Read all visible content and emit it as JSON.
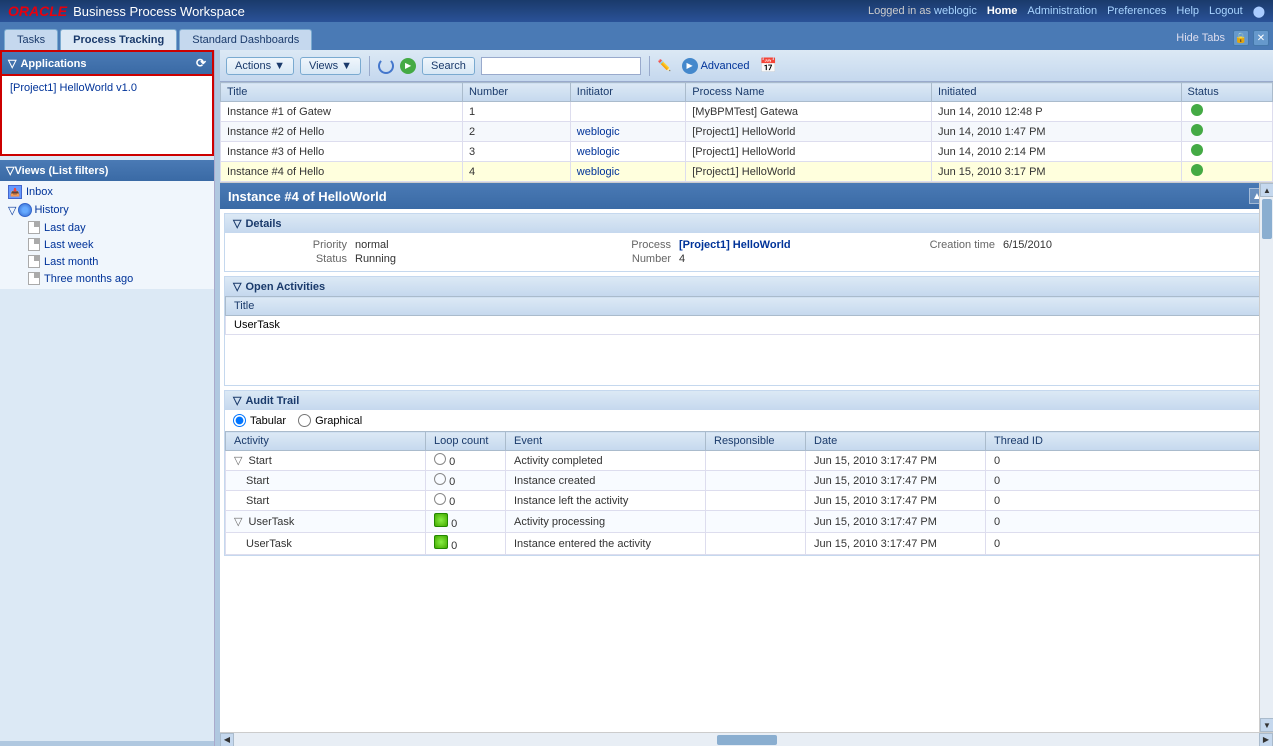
{
  "topbar": {
    "oracle_text": "ORACLE",
    "bpw_text": "Business Process Workspace",
    "logged_in_as": "Logged in as",
    "username": "weblogic",
    "home_label": "Home",
    "administration_label": "Administration",
    "preferences_label": "Preferences",
    "help_label": "Help",
    "logout_label": "Logout"
  },
  "tabs": {
    "tasks_label": "Tasks",
    "process_tracking_label": "Process Tracking",
    "standard_dashboards_label": "Standard Dashboards",
    "hide_tabs_label": "Hide Tabs"
  },
  "sidebar": {
    "applications_label": "Applications",
    "app_items": [
      {
        "label": "[Project1] HelloWorld v1.0"
      }
    ],
    "views_label": "Views (List filters)",
    "inbox_label": "Inbox",
    "history_label": "History",
    "tree_items": [
      {
        "label": "Last day"
      },
      {
        "label": "Last week"
      },
      {
        "label": "Last month"
      },
      {
        "label": "Three months ago"
      }
    ]
  },
  "toolbar": {
    "actions_label": "Actions",
    "views_label": "Views",
    "search_label": "Search",
    "search_placeholder": "",
    "advanced_label": "Advanced"
  },
  "instance_table": {
    "columns": [
      "Title",
      "Number",
      "Initiator",
      "Process Name",
      "Initiated",
      "Status"
    ],
    "rows": [
      {
        "title": "Instance #1 of Gatew",
        "number": "1",
        "initiator": "",
        "process": "[MyBPMTest] Gatewa",
        "initiated": "Jun 14, 2010 12:48 P",
        "status": ""
      },
      {
        "title": "Instance #2 of Hello",
        "number": "2",
        "initiator": "weblogic",
        "process": "[Project1] HelloWorld",
        "initiated": "Jun 14, 2010 1:47 PM",
        "status": ""
      },
      {
        "title": "Instance #3 of Hello",
        "number": "3",
        "initiator": "weblogic",
        "process": "[Project1] HelloWorld",
        "initiated": "Jun 14, 2010 2:14 PM",
        "status": ""
      },
      {
        "title": "Instance #4 of Hello",
        "number": "4",
        "initiator": "weblogic",
        "process": "[Project1] HelloWorld",
        "initiated": "Jun 15, 2010 3:17 PM",
        "status": ""
      }
    ]
  },
  "detail": {
    "title": "Instance #4 of HelloWorld",
    "sections": {
      "details_label": "Details",
      "priority_label": "Priority",
      "priority_value": "normal",
      "status_label": "Status",
      "status_value": "Running",
      "process_label": "Process",
      "process_value": "[Project1] HelloWorld",
      "number_label": "Number",
      "number_value": "4",
      "creation_time_label": "Creation time",
      "creation_time_value": "6/15/2010",
      "open_activities_label": "Open Activities",
      "activities_col": "Title",
      "activity_row": "UserTask",
      "audit_trail_label": "Audit Trail",
      "audit_tabular": "Tabular",
      "audit_graphical": "Graphical",
      "audit_columns": [
        "Activity",
        "Loop count",
        "Event",
        "Responsible",
        "Date",
        "Thread ID"
      ],
      "audit_rows": [
        {
          "indent": false,
          "collapse": true,
          "activity": "Start",
          "loop": "0",
          "event": "Activity completed",
          "responsible": "",
          "date": "Jun 15, 2010 3:17:47 PM",
          "thread": "0"
        },
        {
          "indent": true,
          "collapse": false,
          "activity": "Start",
          "loop": "0",
          "event": "Instance created",
          "responsible": "",
          "date": "Jun 15, 2010 3:17:47 PM",
          "thread": "0"
        },
        {
          "indent": true,
          "collapse": false,
          "activity": "Start",
          "loop": "0",
          "event": "Instance left the activity",
          "responsible": "",
          "date": "Jun 15, 2010 3:17:47 PM",
          "thread": "0"
        },
        {
          "indent": false,
          "collapse": true,
          "activity": "UserTask",
          "loop": "0",
          "event": "Activity processing",
          "responsible": "",
          "date": "Jun 15, 2010 3:17:47 PM",
          "thread": "0"
        },
        {
          "indent": true,
          "collapse": false,
          "activity": "UserTask",
          "loop": "0",
          "event": "Instance entered the activity",
          "responsible": "",
          "date": "Jun 15, 2010 3:17:47 PM",
          "thread": "0"
        }
      ]
    }
  }
}
